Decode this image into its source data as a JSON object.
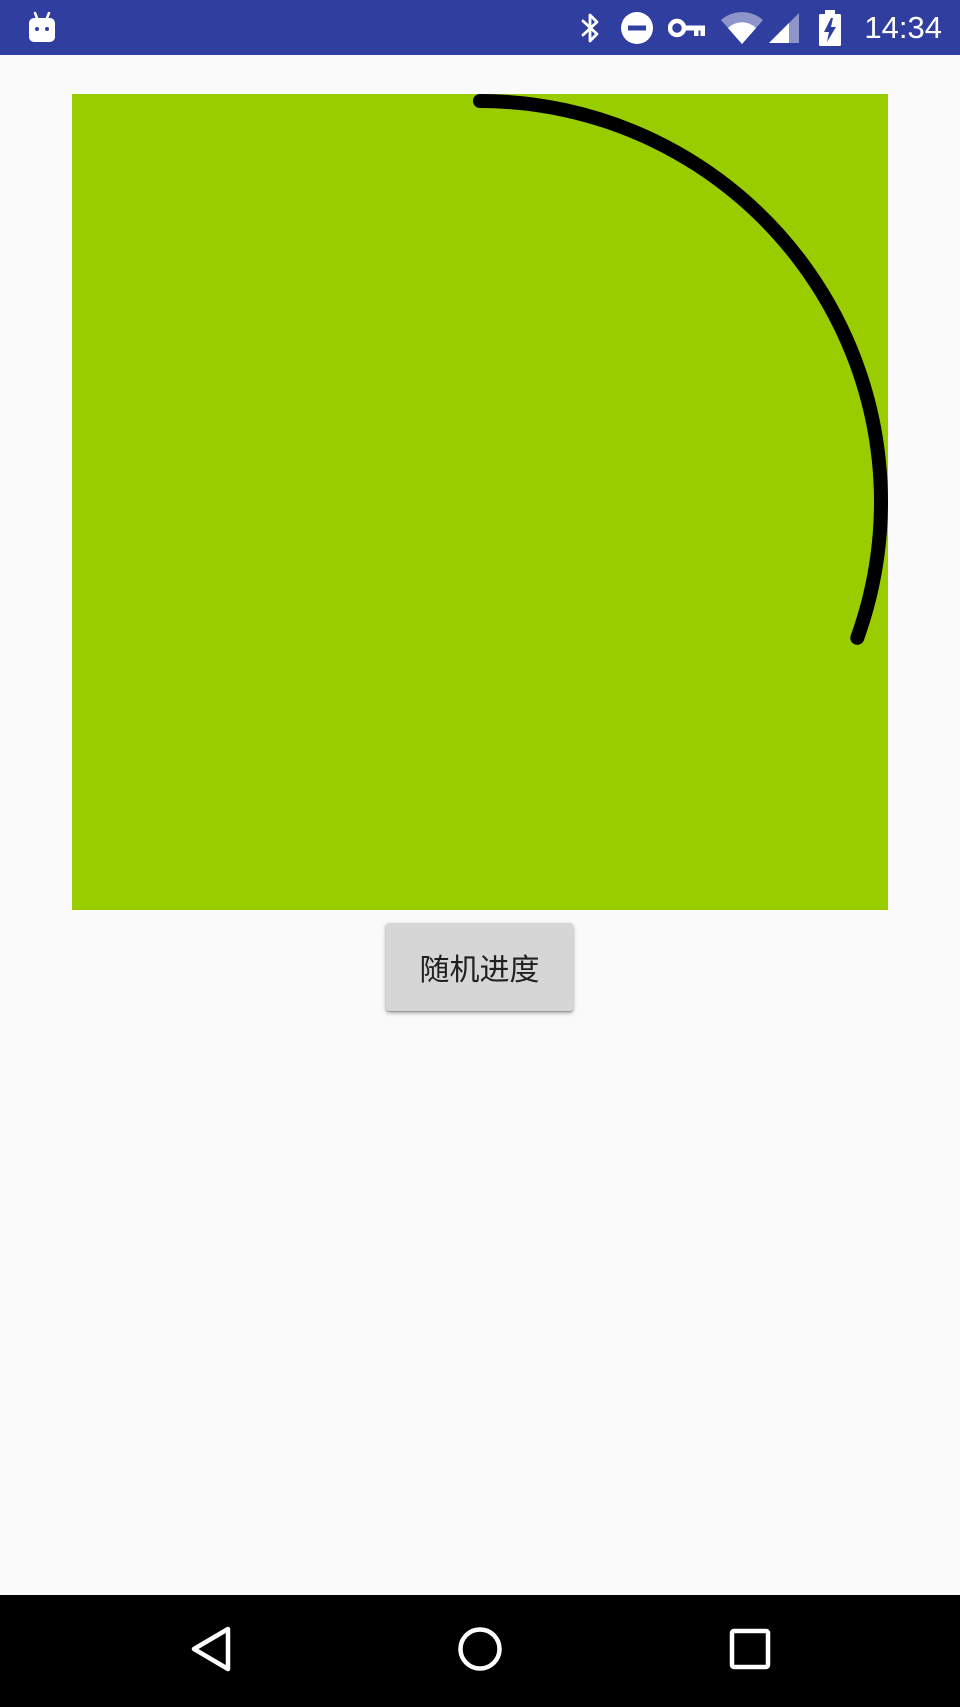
{
  "status_bar": {
    "time": "14:34",
    "background_color": "#303f9f",
    "icons": [
      "android-debug-icon",
      "bluetooth-icon",
      "do-not-disturb-icon",
      "vpn-key-icon",
      "wifi-icon",
      "cell-signal-icon",
      "battery-charging-icon"
    ]
  },
  "progress_view": {
    "background_color": "#9acd00",
    "arc_color": "#000000",
    "progress_fraction": 0.305,
    "start_angle_deg": -90
  },
  "button": {
    "label": "随机进度",
    "background_color": "#d6d6d6"
  },
  "nav_bar": {
    "icons": [
      "back-icon",
      "home-icon",
      "recents-icon"
    ]
  }
}
